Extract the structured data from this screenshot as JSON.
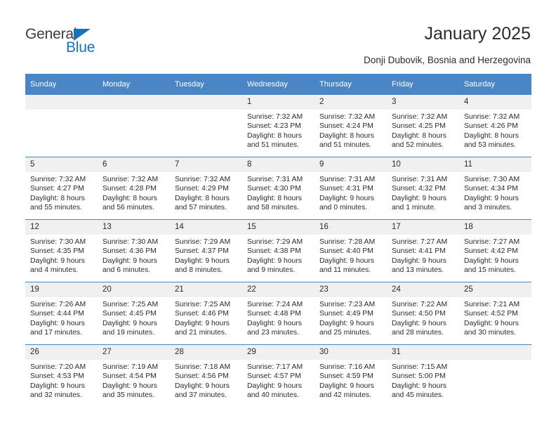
{
  "brand": {
    "name_top": "General",
    "name_bottom": "Blue",
    "accent_color": "#1573b9"
  },
  "header": {
    "title": "January 2025",
    "subtitle": "Donji Dubovik, Bosnia and Herzegovina"
  },
  "calendar": {
    "header_bg": "#4a86c5",
    "daynum_bg": "#f0f0f0",
    "weekday_headers": [
      "Sunday",
      "Monday",
      "Tuesday",
      "Wednesday",
      "Thursday",
      "Friday",
      "Saturday"
    ],
    "labels": {
      "sunrise": "Sunrise:",
      "sunset": "Sunset:",
      "daylight": "Daylight:"
    },
    "weeks": [
      [
        {
          "day": "",
          "blank": true
        },
        {
          "day": "",
          "blank": true
        },
        {
          "day": "",
          "blank": true
        },
        {
          "day": "1",
          "sunrise": "Sunrise: 7:32 AM",
          "sunset": "Sunset: 4:23 PM",
          "daylight_1": "Daylight: 8 hours",
          "daylight_2": "and 51 minutes."
        },
        {
          "day": "2",
          "sunrise": "Sunrise: 7:32 AM",
          "sunset": "Sunset: 4:24 PM",
          "daylight_1": "Daylight: 8 hours",
          "daylight_2": "and 51 minutes."
        },
        {
          "day": "3",
          "sunrise": "Sunrise: 7:32 AM",
          "sunset": "Sunset: 4:25 PM",
          "daylight_1": "Daylight: 8 hours",
          "daylight_2": "and 52 minutes."
        },
        {
          "day": "4",
          "sunrise": "Sunrise: 7:32 AM",
          "sunset": "Sunset: 4:26 PM",
          "daylight_1": "Daylight: 8 hours",
          "daylight_2": "and 53 minutes."
        }
      ],
      [
        {
          "day": "5",
          "sunrise": "Sunrise: 7:32 AM",
          "sunset": "Sunset: 4:27 PM",
          "daylight_1": "Daylight: 8 hours",
          "daylight_2": "and 55 minutes."
        },
        {
          "day": "6",
          "sunrise": "Sunrise: 7:32 AM",
          "sunset": "Sunset: 4:28 PM",
          "daylight_1": "Daylight: 8 hours",
          "daylight_2": "and 56 minutes."
        },
        {
          "day": "7",
          "sunrise": "Sunrise: 7:32 AM",
          "sunset": "Sunset: 4:29 PM",
          "daylight_1": "Daylight: 8 hours",
          "daylight_2": "and 57 minutes."
        },
        {
          "day": "8",
          "sunrise": "Sunrise: 7:31 AM",
          "sunset": "Sunset: 4:30 PM",
          "daylight_1": "Daylight: 8 hours",
          "daylight_2": "and 58 minutes."
        },
        {
          "day": "9",
          "sunrise": "Sunrise: 7:31 AM",
          "sunset": "Sunset: 4:31 PM",
          "daylight_1": "Daylight: 9 hours",
          "daylight_2": "and 0 minutes."
        },
        {
          "day": "10",
          "sunrise": "Sunrise: 7:31 AM",
          "sunset": "Sunset: 4:32 PM",
          "daylight_1": "Daylight: 9 hours",
          "daylight_2": "and 1 minute."
        },
        {
          "day": "11",
          "sunrise": "Sunrise: 7:30 AM",
          "sunset": "Sunset: 4:34 PM",
          "daylight_1": "Daylight: 9 hours",
          "daylight_2": "and 3 minutes."
        }
      ],
      [
        {
          "day": "12",
          "sunrise": "Sunrise: 7:30 AM",
          "sunset": "Sunset: 4:35 PM",
          "daylight_1": "Daylight: 9 hours",
          "daylight_2": "and 4 minutes."
        },
        {
          "day": "13",
          "sunrise": "Sunrise: 7:30 AM",
          "sunset": "Sunset: 4:36 PM",
          "daylight_1": "Daylight: 9 hours",
          "daylight_2": "and 6 minutes."
        },
        {
          "day": "14",
          "sunrise": "Sunrise: 7:29 AM",
          "sunset": "Sunset: 4:37 PM",
          "daylight_1": "Daylight: 9 hours",
          "daylight_2": "and 8 minutes."
        },
        {
          "day": "15",
          "sunrise": "Sunrise: 7:29 AM",
          "sunset": "Sunset: 4:38 PM",
          "daylight_1": "Daylight: 9 hours",
          "daylight_2": "and 9 minutes."
        },
        {
          "day": "16",
          "sunrise": "Sunrise: 7:28 AM",
          "sunset": "Sunset: 4:40 PM",
          "daylight_1": "Daylight: 9 hours",
          "daylight_2": "and 11 minutes."
        },
        {
          "day": "17",
          "sunrise": "Sunrise: 7:27 AM",
          "sunset": "Sunset: 4:41 PM",
          "daylight_1": "Daylight: 9 hours",
          "daylight_2": "and 13 minutes."
        },
        {
          "day": "18",
          "sunrise": "Sunrise: 7:27 AM",
          "sunset": "Sunset: 4:42 PM",
          "daylight_1": "Daylight: 9 hours",
          "daylight_2": "and 15 minutes."
        }
      ],
      [
        {
          "day": "19",
          "sunrise": "Sunrise: 7:26 AM",
          "sunset": "Sunset: 4:44 PM",
          "daylight_1": "Daylight: 9 hours",
          "daylight_2": "and 17 minutes."
        },
        {
          "day": "20",
          "sunrise": "Sunrise: 7:25 AM",
          "sunset": "Sunset: 4:45 PM",
          "daylight_1": "Daylight: 9 hours",
          "daylight_2": "and 19 minutes."
        },
        {
          "day": "21",
          "sunrise": "Sunrise: 7:25 AM",
          "sunset": "Sunset: 4:46 PM",
          "daylight_1": "Daylight: 9 hours",
          "daylight_2": "and 21 minutes."
        },
        {
          "day": "22",
          "sunrise": "Sunrise: 7:24 AM",
          "sunset": "Sunset: 4:48 PM",
          "daylight_1": "Daylight: 9 hours",
          "daylight_2": "and 23 minutes."
        },
        {
          "day": "23",
          "sunrise": "Sunrise: 7:23 AM",
          "sunset": "Sunset: 4:49 PM",
          "daylight_1": "Daylight: 9 hours",
          "daylight_2": "and 25 minutes."
        },
        {
          "day": "24",
          "sunrise": "Sunrise: 7:22 AM",
          "sunset": "Sunset: 4:50 PM",
          "daylight_1": "Daylight: 9 hours",
          "daylight_2": "and 28 minutes."
        },
        {
          "day": "25",
          "sunrise": "Sunrise: 7:21 AM",
          "sunset": "Sunset: 4:52 PM",
          "daylight_1": "Daylight: 9 hours",
          "daylight_2": "and 30 minutes."
        }
      ],
      [
        {
          "day": "26",
          "sunrise": "Sunrise: 7:20 AM",
          "sunset": "Sunset: 4:53 PM",
          "daylight_1": "Daylight: 9 hours",
          "daylight_2": "and 32 minutes."
        },
        {
          "day": "27",
          "sunrise": "Sunrise: 7:19 AM",
          "sunset": "Sunset: 4:54 PM",
          "daylight_1": "Daylight: 9 hours",
          "daylight_2": "and 35 minutes."
        },
        {
          "day": "28",
          "sunrise": "Sunrise: 7:18 AM",
          "sunset": "Sunset: 4:56 PM",
          "daylight_1": "Daylight: 9 hours",
          "daylight_2": "and 37 minutes."
        },
        {
          "day": "29",
          "sunrise": "Sunrise: 7:17 AM",
          "sunset": "Sunset: 4:57 PM",
          "daylight_1": "Daylight: 9 hours",
          "daylight_2": "and 40 minutes."
        },
        {
          "day": "30",
          "sunrise": "Sunrise: 7:16 AM",
          "sunset": "Sunset: 4:59 PM",
          "daylight_1": "Daylight: 9 hours",
          "daylight_2": "and 42 minutes."
        },
        {
          "day": "31",
          "sunrise": "Sunrise: 7:15 AM",
          "sunset": "Sunset: 5:00 PM",
          "daylight_1": "Daylight: 9 hours",
          "daylight_2": "and 45 minutes."
        },
        {
          "day": "",
          "blank": true
        }
      ]
    ]
  }
}
